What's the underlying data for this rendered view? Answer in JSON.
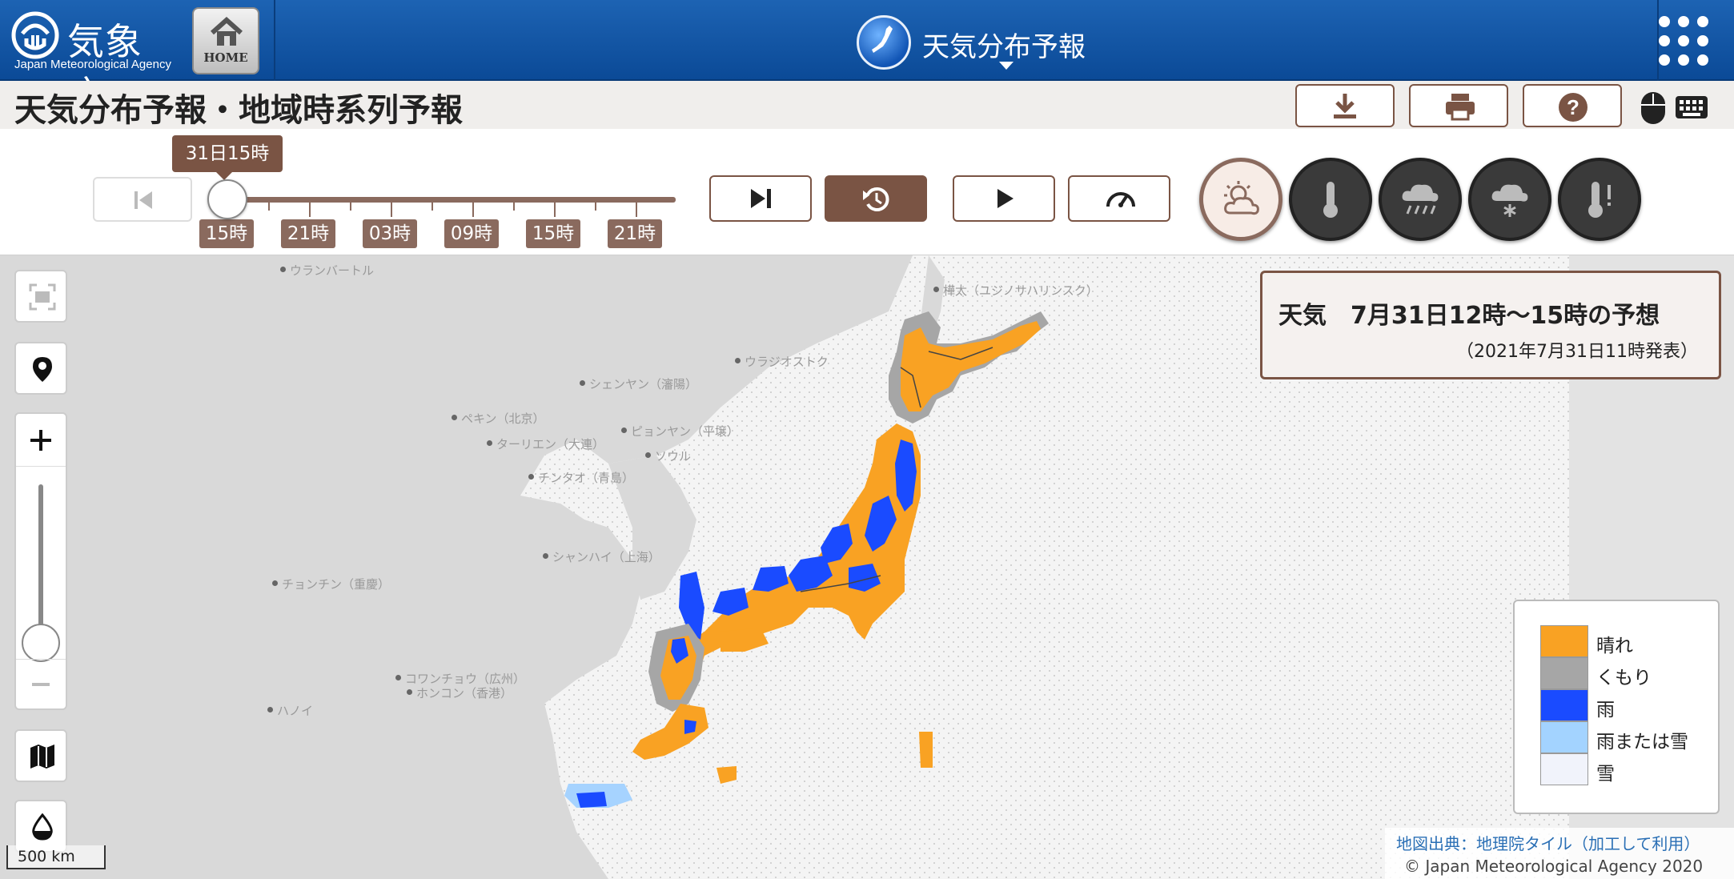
{
  "header": {
    "agency_name": "気象庁",
    "agency_sub": "Japan Meteorological Agency",
    "home_label": "HOME",
    "app_title": "天気分布予報"
  },
  "titlebar": {
    "page_title": "天気分布予報・地域時系列予報",
    "buttons": [
      "download-icon",
      "print-icon",
      "help-icon"
    ],
    "input_icons": [
      "mouse-icon",
      "keyboard-icon"
    ]
  },
  "timeline": {
    "current_time": "31日15時",
    "ticks": [
      "15時",
      "21時",
      "03時",
      "09時",
      "15時",
      "21時"
    ],
    "slider_position": 0
  },
  "mode_buttons": [
    "weather-icon",
    "temperature-icon",
    "precipitation-icon",
    "snowfall-icon",
    "max-temperature-icon"
  ],
  "map": {
    "places": [
      "ウランバートル",
      "樺太（ユジノサハリンスク）",
      "ウラジオストク",
      "シェンヤン（瀋陽）",
      "ペキン（北京）",
      "ピョンヤン（平壌）",
      "ターリエン（大連）",
      "ソウル",
      "チンタオ（青島）",
      "シャンハイ（上海）",
      "チョンチン（重慶）",
      "コワンチョウ（広州）",
      "ホンコン（香港）",
      "ハノイ"
    ],
    "zoom_level": 0.35
  },
  "info": {
    "title": "天気　7月31日12時～15時の予想",
    "issued": "（2021年7月31日11時発表）"
  },
  "legend": [
    {
      "label": "晴れ",
      "color": "#f9a223"
    },
    {
      "label": "くもり",
      "color": "#a6a6a6"
    },
    {
      "label": "雨",
      "color": "#1a4bff"
    },
    {
      "label": "雨または雪",
      "color": "#a3d3ff"
    },
    {
      "label": "雪",
      "color": "#f1f3fb"
    }
  ],
  "scale_label": "500 km",
  "attribution": {
    "source": "地図出典：地理院タイル（加工して利用）",
    "copyright": "© Japan Meteorological Agency 2020"
  }
}
